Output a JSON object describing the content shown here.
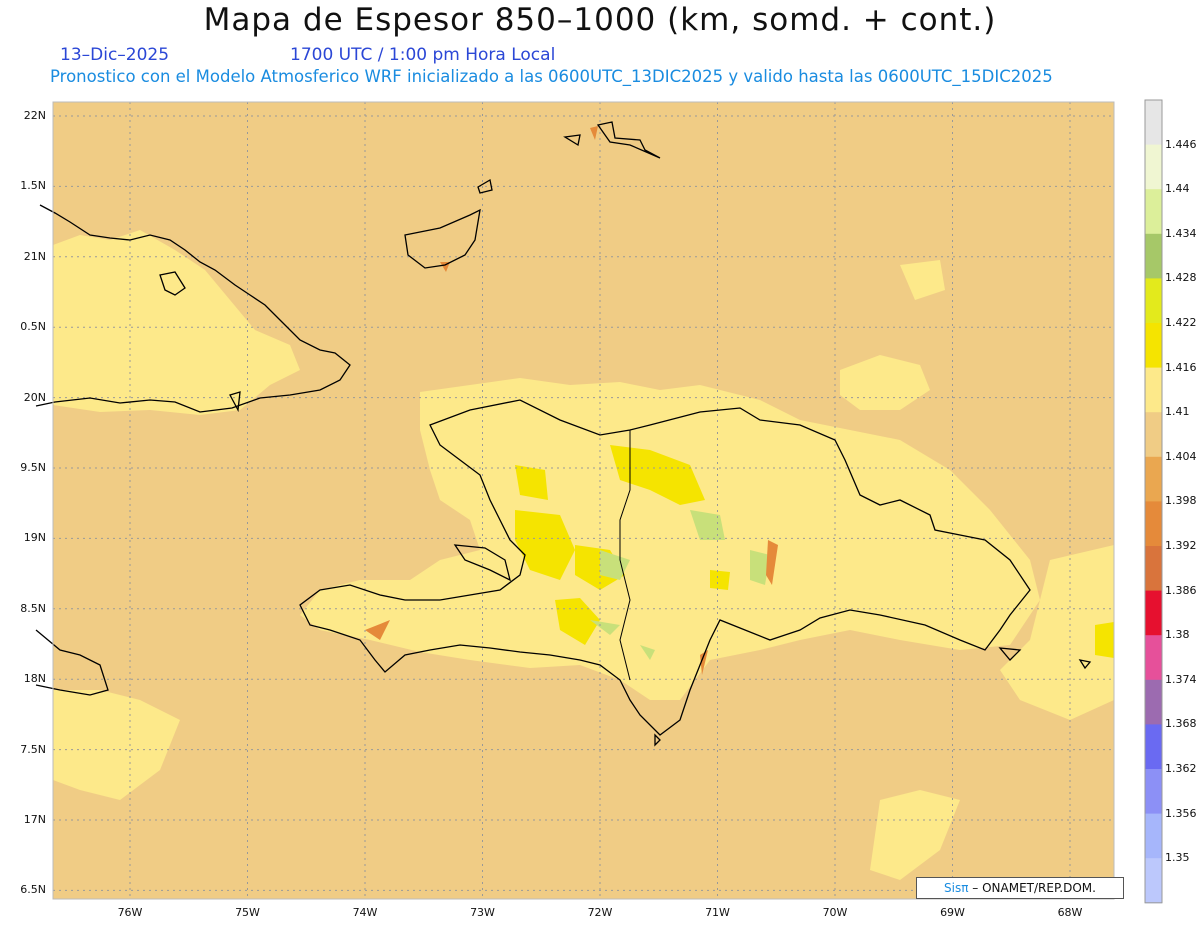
{
  "header": {
    "title": "Mapa de Espesor 850–1000 (km, somd. + cont.)",
    "date": "13–Dic–2025",
    "time": "1700 UTC / 1:00 pm Hora Local",
    "model_line": "Pronostico con el Modelo Atmosferico WRF inicializado a las 0600UTC_13DIC2025 y valido hasta las  0600UTC_15DIC2025"
  },
  "axes": {
    "lat_labels": [
      "22N",
      "1.5N",
      "21N",
      "0.5N",
      "20N",
      "9.5N",
      "19N",
      "8.5N",
      "18N",
      "7.5N",
      "17N",
      "6.5N"
    ],
    "lon_labels": [
      "76W",
      "75W",
      "74W",
      "73W",
      "72W",
      "71W",
      "70W",
      "69W",
      "68W"
    ]
  },
  "colorbar": {
    "labels": [
      "1.446",
      "1.44",
      "1.434",
      "1.428",
      "1.422",
      "1.416",
      "1.41",
      "1.404",
      "1.398",
      "1.392",
      "1.386",
      "1.38",
      "1.374",
      "1.368",
      "1.362",
      "1.356",
      "1.35"
    ],
    "colors": [
      "#e6e6e6",
      "#f0f6d2",
      "#dcef9a",
      "#a6c868",
      "#e3ea1c",
      "#f5e400",
      "#fde98a",
      "#f0cc85",
      "#eaa750",
      "#e58a3a",
      "#d9743c",
      "#e6102f",
      "#e6509a",
      "#9c6bb0",
      "#6a6af2",
      "#8c90f6",
      "#a6b6fb",
      "#bcc8fc"
    ]
  },
  "credit": {
    "brand": "Sisπ",
    "text": "– ONAMET/REP.DOM."
  }
}
